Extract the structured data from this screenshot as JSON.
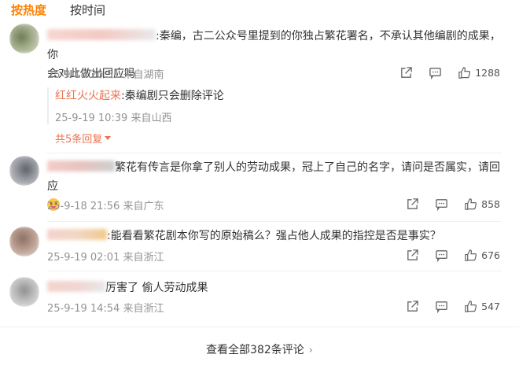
{
  "tabs": {
    "hot": "按热度",
    "time": "按时间"
  },
  "comments": [
    {
      "text_line1": ":秦编，古二公众号里提到的你独占繁花署名，不承认其他编剧的成果，你",
      "text_line2": "会对此做出回应吗",
      "meta": "25-9-18 20:51 来自湖南",
      "likes": "1288",
      "reply": {
        "user": "红红火火起来",
        "text": ":秦编剧只会删除评论",
        "meta": "25-9-19 10:39 来自山西",
        "more": "共5条回复"
      }
    },
    {
      "text_line1": "繁花有传言是你拿了别人的劳动成果，冠上了自己的名字，请问是否属实，请回应",
      "meta": "25-9-18 21:56 来自广东",
      "likes": "858"
    },
    {
      "text_line1": ":能看看繁花剧本你写的原始稿么？强占他人成果的指控是否是事实？",
      "meta": "25-9-19 02:01 来自浙江",
      "likes": "676"
    },
    {
      "text_line1": "厉害了  偷人劳动成果",
      "meta": "25-9-19 14:54 来自浙江",
      "likes": "547"
    }
  ],
  "footer": {
    "view_all": "查看全部382条评论"
  },
  "icons": {
    "share": "share-icon",
    "comment": "comment-icon",
    "like": "thumbs-up-icon",
    "chevron": "chevron-right-icon"
  },
  "colors": {
    "accent": "#ff8200",
    "reply_user": "#eb7350",
    "meta": "#939393"
  }
}
